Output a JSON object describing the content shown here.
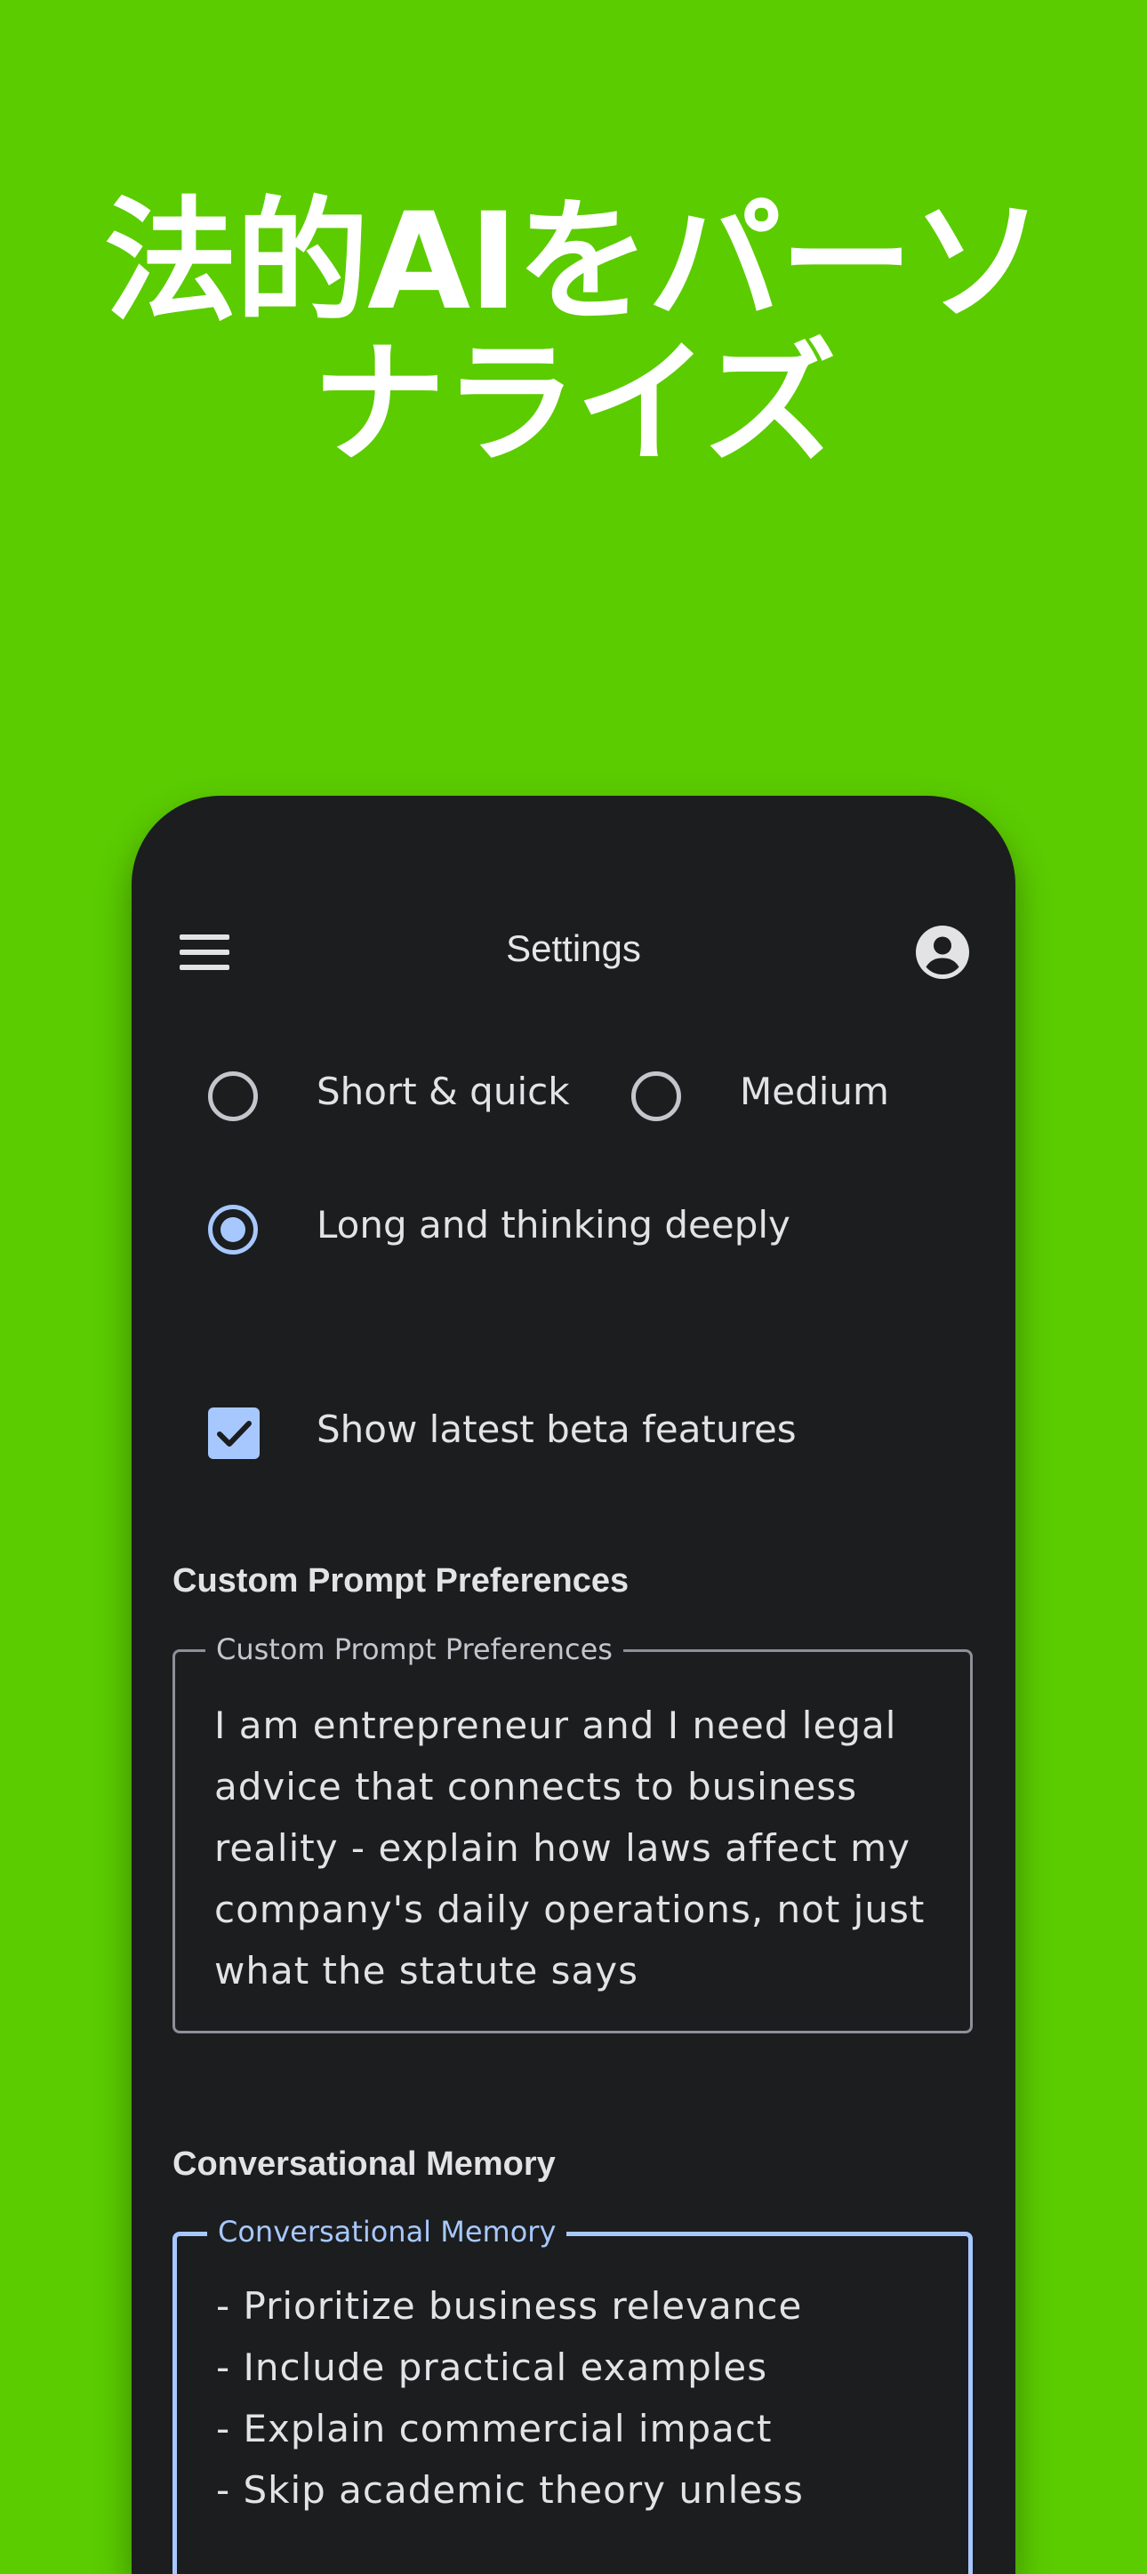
{
  "headline": {
    "line1": "法的AIをパーソ",
    "line2": "ナライズ"
  },
  "colors": {
    "background": "#5bcc00",
    "surface": "#1c1d1f",
    "accent": "#a7c8ff",
    "text": "#e3e3e6"
  },
  "appbar": {
    "title": "Settings",
    "menu_icon": "menu-icon",
    "account_icon": "account-circle-icon"
  },
  "response_length": {
    "options": [
      {
        "label": "Short & quick",
        "selected": false
      },
      {
        "label": "Medium",
        "selected": false
      },
      {
        "label": "Long and thinking deeply",
        "selected": true
      }
    ]
  },
  "beta": {
    "label": "Show latest beta features",
    "checked": true
  },
  "custom_prompt": {
    "section_title": "Custom Prompt Preferences",
    "field_label": "Custom Prompt Preferences",
    "lines": [
      "I am entrepreneur and I  need legal",
      "advice that connects to business",
      "reality - explain how laws affect my",
      "company's daily operations, not just",
      "what the statute says"
    ]
  },
  "memory": {
    "section_title": "Conversational Memory",
    "field_label": "Conversational Memory",
    "lines": [
      "- Prioritize business relevance",
      "- Include practical examples",
      "- Explain commercial impact",
      "- Skip academic theory unless"
    ]
  }
}
